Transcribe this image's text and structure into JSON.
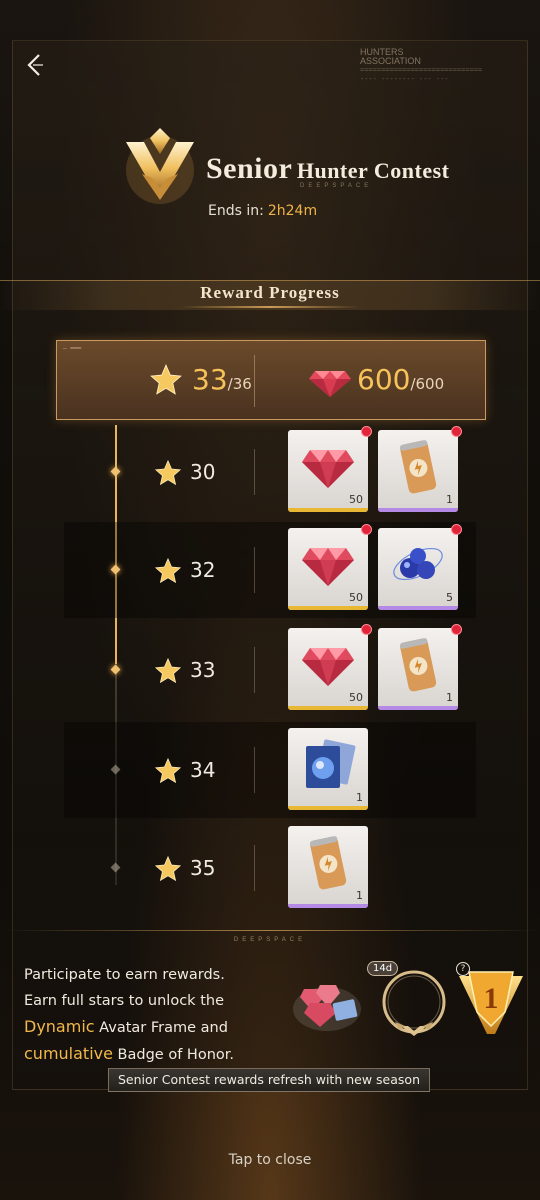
{
  "header": {
    "back_icon": "chevron-left-icon",
    "deco_title": "HUNTERS",
    "deco_title2": "ASSOCIATION",
    "title_part1": "Senior",
    "title_part2": "Hunter Contest",
    "brand_sub": "DEEPSPACE",
    "ends_label": "Ends in:",
    "ends_value": "2h24m"
  },
  "section": {
    "title": "Reward Progress"
  },
  "summary": {
    "stars_current": "33",
    "stars_total": "/36",
    "gems_current": "600",
    "gems_total": "/600"
  },
  "milestones": [
    {
      "stars": "30",
      "reached": true,
      "rewards": [
        {
          "icon": "gem-icon",
          "qty": "50",
          "rarity": "gold",
          "new": true
        },
        {
          "icon": "energy-can-icon",
          "qty": "1",
          "rarity": "purple",
          "new": true
        }
      ]
    },
    {
      "stars": "32",
      "reached": true,
      "rewards": [
        {
          "icon": "gem-icon",
          "qty": "50",
          "rarity": "gold",
          "new": true
        },
        {
          "icon": "blue-orbs-icon",
          "qty": "5",
          "rarity": "purple",
          "new": true
        }
      ]
    },
    {
      "stars": "33",
      "reached": true,
      "rewards": [
        {
          "icon": "gem-icon",
          "qty": "50",
          "rarity": "gold",
          "new": true
        },
        {
          "icon": "energy-can-icon",
          "qty": "1",
          "rarity": "purple",
          "new": true
        }
      ]
    },
    {
      "stars": "34",
      "reached": false,
      "rewards": [
        {
          "icon": "card-ticket-icon",
          "qty": "1",
          "rarity": "gold",
          "new": false
        }
      ]
    },
    {
      "stars": "35",
      "reached": false,
      "rewards": [
        {
          "icon": "energy-can-icon",
          "qty": "1",
          "rarity": "purple",
          "new": false
        }
      ]
    }
  ],
  "footer": {
    "line1": "Participate to earn rewards.",
    "line2": "Earn full stars to unlock the",
    "line3_hl": "Dynamic",
    "line3_rest": " Avatar Frame and",
    "line4_hl": "cumulative",
    "line4_rest": " Badge of Honor.",
    "frame_duration": "14d",
    "honor_rank": "1",
    "help_mark": "?",
    "refresh_note": "Senior Contest rewards refresh with new season",
    "close_hint": "Tap to close"
  },
  "colors": {
    "accent_gold": "#f2b84a",
    "new_dot": "#e0253a",
    "rarity_gold": "#e8b834",
    "rarity_purple": "#b48ae6"
  }
}
